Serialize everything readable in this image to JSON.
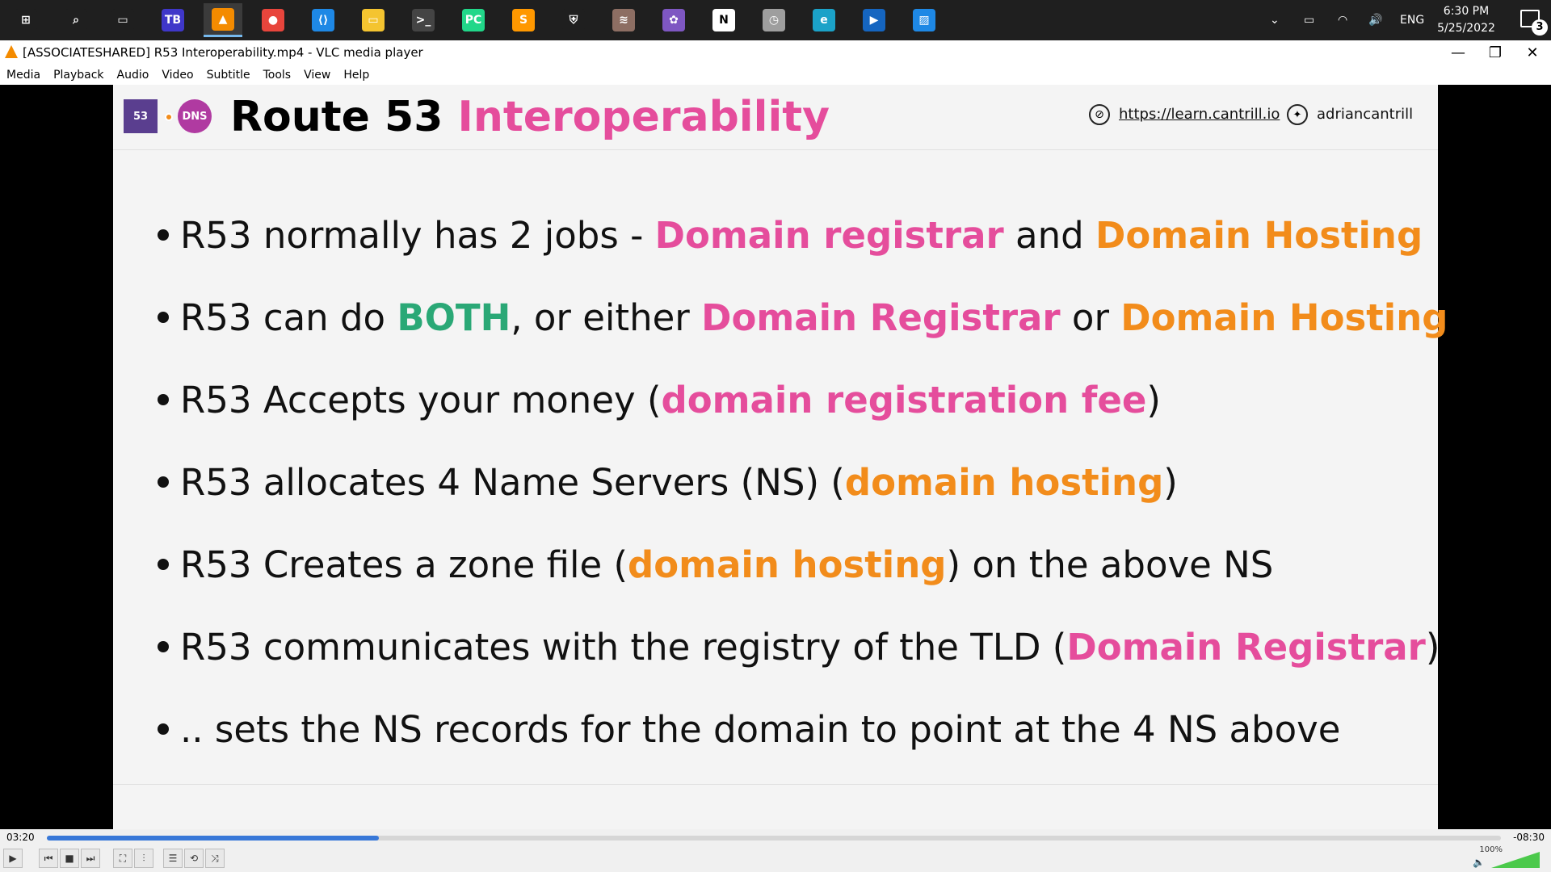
{
  "taskbar": {
    "apps": [
      {
        "name": "start-button",
        "glyph": "⊞",
        "color": "#1f1f1f"
      },
      {
        "name": "search-icon",
        "glyph": "⌕",
        "color": "#1f1f1f"
      },
      {
        "name": "task-view-icon",
        "glyph": "▭",
        "color": "#1f1f1f"
      },
      {
        "name": "jetbrains-toolbox-icon",
        "glyph": "TB",
        "color": "#3f37c9"
      },
      {
        "name": "vlc-icon",
        "glyph": "▲",
        "color": "#f48b00"
      },
      {
        "name": "chrome-icon",
        "glyph": "●",
        "color": "#e8453c"
      },
      {
        "name": "vscode-icon",
        "glyph": "⟨⟩",
        "color": "#1e88e5"
      },
      {
        "name": "file-explorer-icon",
        "glyph": "▭",
        "color": "#f4c430"
      },
      {
        "name": "terminal-icon",
        "glyph": ">_",
        "color": "#444444"
      },
      {
        "name": "pycharm-icon",
        "glyph": "PC",
        "color": "#21d789"
      },
      {
        "name": "sublime-icon",
        "glyph": "S",
        "color": "#ff9800"
      },
      {
        "name": "security-shield-icon",
        "glyph": "⛨",
        "color": "#1f1f1f"
      },
      {
        "name": "app-stack-icon",
        "glyph": "≋",
        "color": "#8d6e63"
      },
      {
        "name": "vlc-alt-icon",
        "glyph": "✿",
        "color": "#7e57c2"
      },
      {
        "name": "notion-icon",
        "glyph": "N",
        "color": "#ffffff"
      },
      {
        "name": "clock-app-icon",
        "glyph": "◷",
        "color": "#9e9e9e"
      },
      {
        "name": "edge-icon",
        "glyph": "e",
        "color": "#1ba2c8"
      },
      {
        "name": "media-player-icon",
        "glyph": "▶",
        "color": "#1565c0"
      },
      {
        "name": "photos-icon",
        "glyph": "▨",
        "color": "#1e88e5"
      }
    ],
    "language": "ENG",
    "time": "6:30 PM",
    "date": "5/25/2022",
    "notification_count": "3"
  },
  "window": {
    "title": "[ASSOCIATESHARED] R53 Interoperability.mp4 - VLC media player",
    "minimize": "—",
    "maximize": "❐",
    "close": "✕"
  },
  "menu": [
    "Media",
    "Playback",
    "Audio",
    "Video",
    "Subtitle",
    "Tools",
    "View",
    "Help"
  ],
  "slide": {
    "badge_53": "53",
    "badge_dns": "DNS",
    "title_main": "Route 53 ",
    "title_accent": "Interoperability",
    "link": "https://learn.cantrill.io",
    "twitter": "adriancantrill",
    "bullets": [
      [
        {
          "t": "R53 normally has 2 jobs - ",
          "c": ""
        },
        {
          "t": "Domain registrar",
          "c": "pink"
        },
        {
          "t": " and ",
          "c": ""
        },
        {
          "t": "Domain Hosting",
          "c": "orange"
        }
      ],
      [
        {
          "t": "R53 can do ",
          "c": ""
        },
        {
          "t": "BOTH",
          "c": "green"
        },
        {
          "t": ", or either ",
          "c": ""
        },
        {
          "t": "Domain Registrar",
          "c": "pink"
        },
        {
          "t": " or ",
          "c": ""
        },
        {
          "t": "Domain Hosting",
          "c": "orange"
        }
      ],
      [
        {
          "t": "R53 Accepts your money (",
          "c": ""
        },
        {
          "t": "domain registration fee",
          "c": "pink"
        },
        {
          "t": ")",
          "c": ""
        }
      ],
      [
        {
          "t": "R53 allocates 4 Name Servers (NS) (",
          "c": ""
        },
        {
          "t": "domain hosting",
          "c": "orange"
        },
        {
          "t": ")",
          "c": ""
        }
      ],
      [
        {
          "t": "R53 Creates a zone file (",
          "c": ""
        },
        {
          "t": "domain hosting",
          "c": "orange"
        },
        {
          "t": ") on the above NS",
          "c": ""
        }
      ],
      [
        {
          "t": "R53 communicates with the registry of the TLD (",
          "c": ""
        },
        {
          "t": "Domain Registrar",
          "c": "pink"
        },
        {
          "t": ")",
          "c": ""
        }
      ],
      [
        {
          "t": ".. sets the NS records for the domain to point at the 4 NS above",
          "c": ""
        }
      ]
    ]
  },
  "player": {
    "elapsed": "03:20",
    "remaining": "-08:30",
    "progress_fraction": 0.2286,
    "volume": "100%",
    "buttons": [
      {
        "name": "play-button",
        "glyph": "▶"
      },
      {
        "name": "previous-button",
        "glyph": "⏮"
      },
      {
        "name": "stop-button",
        "glyph": "■"
      },
      {
        "name": "next-button",
        "glyph": "⏭"
      },
      {
        "name": "fullscreen-button",
        "glyph": "⛶"
      },
      {
        "name": "extended-settings-button",
        "glyph": "⫶"
      },
      {
        "name": "playlist-button",
        "glyph": "☰"
      },
      {
        "name": "loop-button",
        "glyph": "⟲"
      },
      {
        "name": "shuffle-button",
        "glyph": "⤨"
      }
    ]
  }
}
